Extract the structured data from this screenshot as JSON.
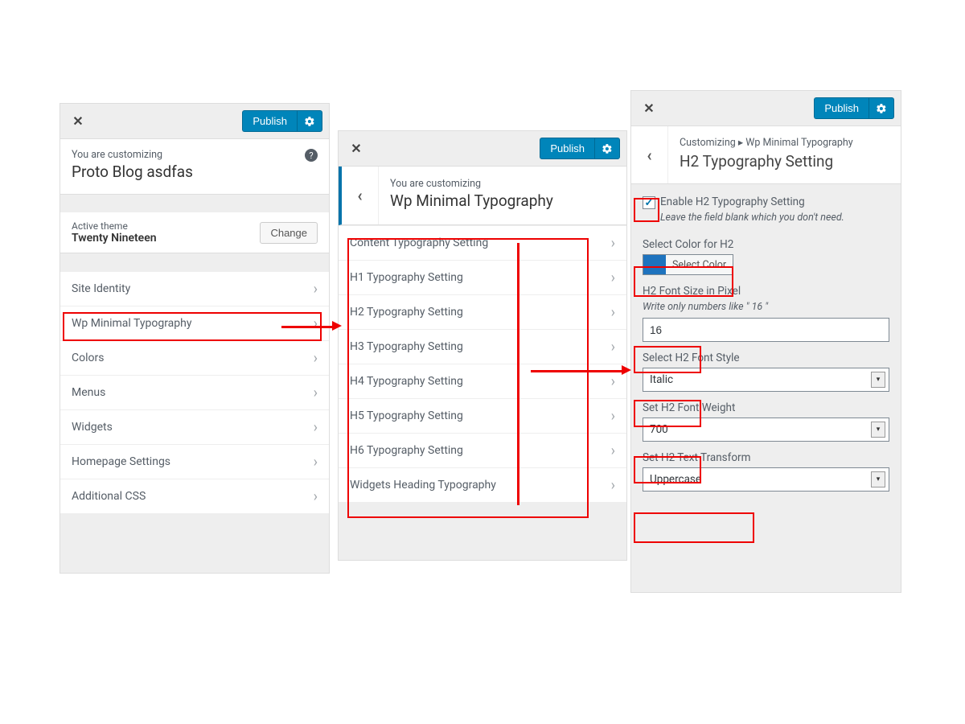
{
  "common": {
    "publish_label": "Publish"
  },
  "panel_a": {
    "customizing_label": "You are customizing",
    "site_title": "Proto Blog asdfas",
    "active_theme_label": "Active theme",
    "theme_name": "Twenty Nineteen",
    "change_label": "Change",
    "menu": [
      "Site Identity",
      "Wp Minimal Typography",
      "Colors",
      "Menus",
      "Widgets",
      "Homepage Settings",
      "Additional CSS"
    ]
  },
  "panel_b": {
    "customizing_label": "You are customizing",
    "title": "Wp Minimal Typography",
    "menu": [
      "Content Typography Setting",
      "H1 Typography Setting",
      "H2 Typography Setting",
      "H3 Typography Setting",
      "H4 Typography Setting",
      "H5 Typography Setting",
      "H6 Typography Setting",
      "Widgets Heading Typography"
    ]
  },
  "panel_c": {
    "crumb_prefix": "Customizing",
    "crumb_separator": "▸",
    "crumb_section": "Wp Minimal Typography",
    "title": "H2 Typography Setting",
    "enable_label": "Enable H2 Typography Setting",
    "enable_hint": "Leave the field blank which you don't need.",
    "color_label": "Select Color for H2",
    "color_button": "Select Color",
    "color_value": "#1e73be",
    "fontsize_label": "H2 Font Size in Pixel",
    "fontsize_hint": "Write only numbers like \" 16 \"",
    "fontsize_value": "16",
    "fontstyle_label": "Select H2 Font Style",
    "fontstyle_value": "Italic",
    "fontweight_label": "Set H2 Font Weight",
    "fontweight_value": "700",
    "transform_label": "Set H2 Text Transform",
    "transform_value": "Uppercase"
  }
}
